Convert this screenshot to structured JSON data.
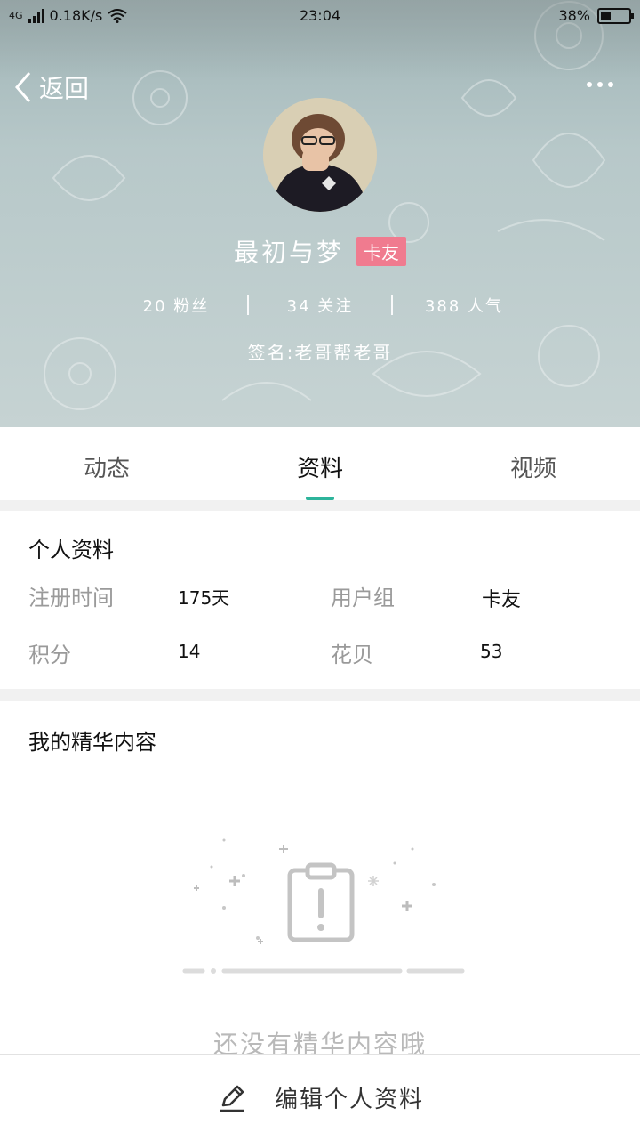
{
  "status_bar": {
    "network": "4G",
    "speed": "0.18K/s",
    "time": "23:04",
    "battery_percent": "38%",
    "battery_level": 0.38
  },
  "header": {
    "back_label": "返回",
    "username": "最初与梦",
    "badge": "卡友",
    "stats": [
      {
        "label": "20 粉丝"
      },
      {
        "label": "34 关注"
      },
      {
        "label": "388 人气"
      }
    ],
    "signature": "签名:老哥帮老哥"
  },
  "tabs": [
    {
      "label": "动态",
      "active": false
    },
    {
      "label": "资料",
      "active": true
    },
    {
      "label": "视频",
      "active": false
    }
  ],
  "profile": {
    "title": "个人资料",
    "register_label": "注册时间",
    "register_value": "175天",
    "group_label": "用户组",
    "group_value": "卡友",
    "points_label": "积分",
    "points_value": "14",
    "flower_label": "花贝",
    "flower_value": "53"
  },
  "featured": {
    "title": "我的精华内容",
    "empty_text": "还没有精华内容哦"
  },
  "bottom": {
    "edit_label": "编辑个人资料"
  },
  "colors": {
    "accent": "#2db49b",
    "badge": "#f07b8f"
  }
}
